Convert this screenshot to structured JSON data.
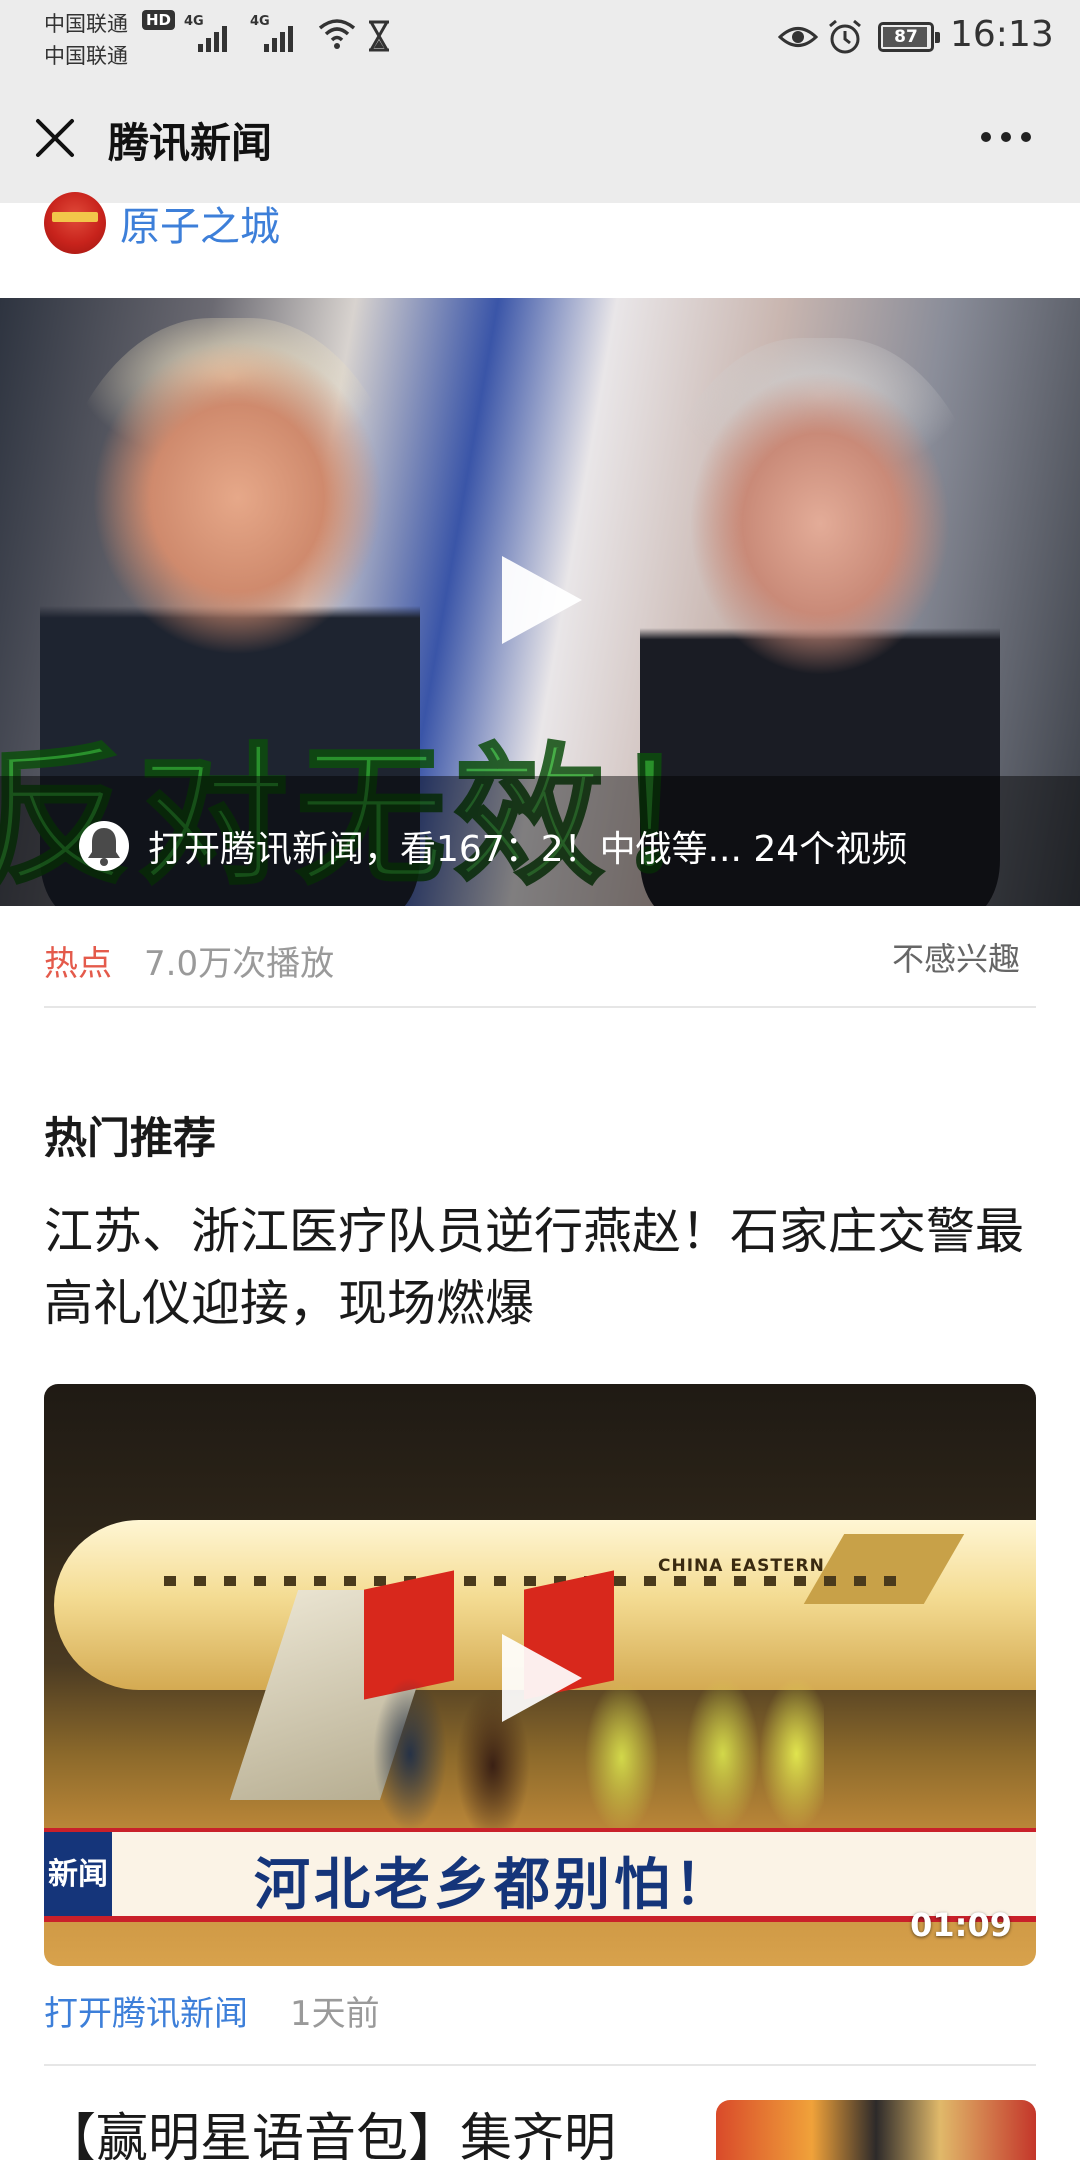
{
  "status_bar": {
    "carrier_1": "中国联通",
    "carrier_2": "中国联通",
    "hd_badge": "HD",
    "network_1": "4G",
    "network_2": "4G",
    "battery_level": "87",
    "time": "16:13"
  },
  "nav": {
    "title": "腾讯新闻"
  },
  "author": {
    "name": "原子之城"
  },
  "video_1": {
    "overlay_text": "反对无效！",
    "caption": "打开腾讯新闻，看167：2！中俄等... 24个视频"
  },
  "meta": {
    "hot_tag": "热点",
    "play_count": "7.0万次播放",
    "not_interested": "不感兴趣"
  },
  "recommend": {
    "section_title": "热门推荐",
    "article_title": "江苏、浙江医疗队员逆行燕赵！石家庄交警最高礼仪迎接，现场燃爆",
    "video": {
      "plane_label": "CHINA EASTERN",
      "banner_tag": "新闻",
      "banner_text": "河北老乡都别怕！",
      "duration": "01:09"
    },
    "open_link": "打开腾讯新闻",
    "time_ago": "1天前"
  },
  "next_article": {
    "title": "【赢明星语音包】集齐明"
  }
}
